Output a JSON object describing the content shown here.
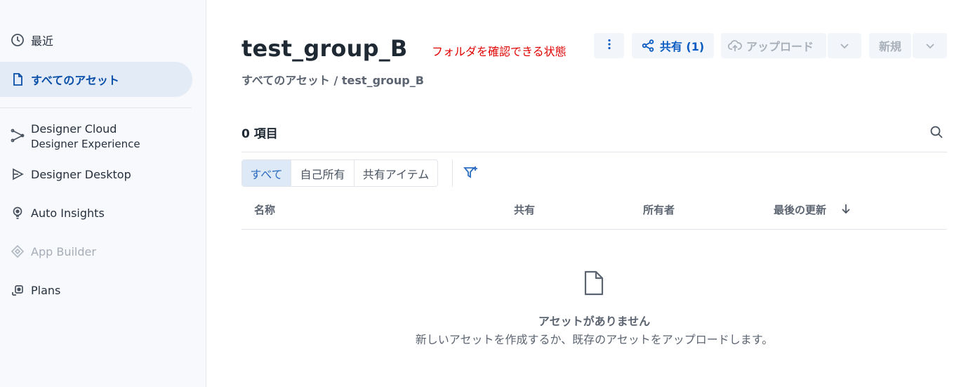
{
  "sidebar": {
    "items": [
      {
        "label": "最近",
        "icon": "clock-icon"
      },
      {
        "label": "すべてのアセット",
        "icon": "file-icon"
      },
      {
        "label": "Designer Cloud",
        "sublabel": "Designer Experience",
        "icon": "designer-cloud-icon"
      },
      {
        "label": "Designer Desktop",
        "icon": "designer-desktop-icon"
      },
      {
        "label": "Auto Insights",
        "icon": "lightbulb-icon"
      },
      {
        "label": "App Builder",
        "icon": "app-builder-icon"
      },
      {
        "label": "Plans",
        "icon": "plans-icon"
      }
    ]
  },
  "header": {
    "title": "test_group_B",
    "annotation": "フォルダを確認できる状態",
    "breadcrumb": "すべてのアセット / test_group_B"
  },
  "toolbar": {
    "more_icon": "more-vertical-icon",
    "share_label": "共有 (1)",
    "upload_label": "アップロード",
    "new_label": "新規"
  },
  "content": {
    "count_label": "0 項目",
    "filters": [
      "すべて",
      "自己所有",
      "共有アイテム"
    ],
    "columns": {
      "name": "名称",
      "shared": "共有",
      "owner": "所有者",
      "updated": "最後の更新"
    },
    "empty_title": "アセットがありません",
    "empty_subtitle": "新しいアセットを作成するか、既存のアセットをアップロードします。"
  },
  "colors": {
    "accent": "#0a5cc2",
    "active_bg": "#e3ebf6",
    "annotation": "#e00000"
  }
}
